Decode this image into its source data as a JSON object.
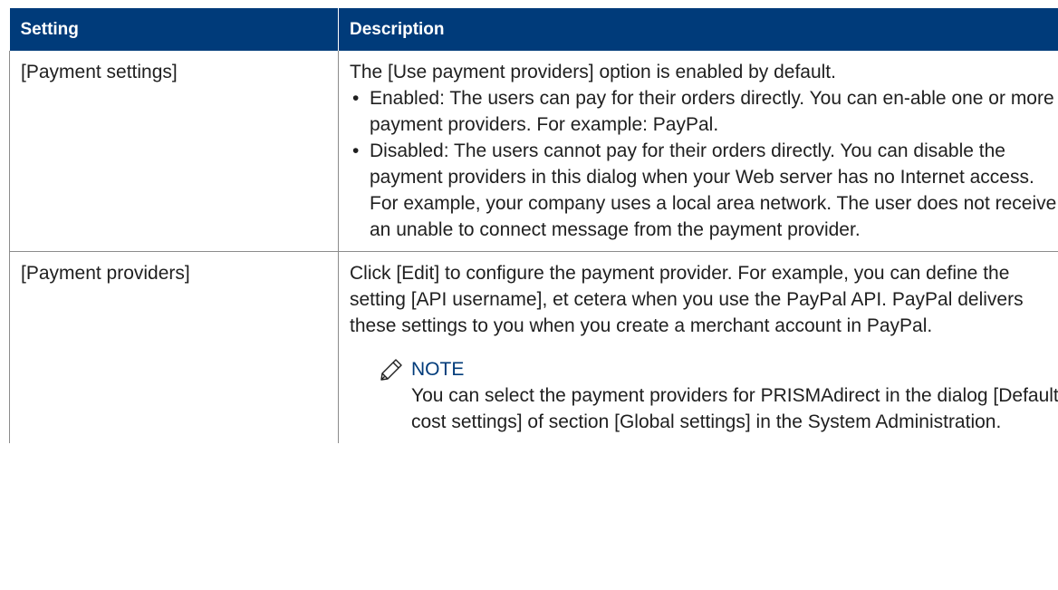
{
  "table": {
    "headers": {
      "setting": "Setting",
      "description": "Description"
    },
    "rows": [
      {
        "setting": "[Payment settings]",
        "intro": "The [Use payment providers] option is enabled by default.",
        "bullets": [
          "Enabled: The users can pay for their orders directly. You can en-able one or more payment providers. For example: PayPal.",
          "Disabled: The users cannot pay for their orders directly. You can disable the payment providers in this dialog when your Web server has no Internet access. For example, your company uses a local area network. The user does not receive an unable to connect message from the payment provider."
        ]
      },
      {
        "setting": "[Payment providers]",
        "description": "Click [Edit] to configure the payment provider. For example, you can define the setting [API username], et cetera when you use the PayPal API. PayPal delivers these settings to you when you create a merchant account in PayPal.",
        "note": {
          "title": "NOTE",
          "text": "You can select the payment providers for PRISMAdirect in the dialog [Default cost settings] of section [Global settings] in the System Administration."
        }
      }
    ]
  },
  "icons": {
    "note": "pencil-icon",
    "bullet": "•"
  },
  "colors": {
    "header_bg": "#003b7a",
    "header_text": "#ffffff",
    "note_title": "#003b7a",
    "border": "#8c8c8c"
  }
}
